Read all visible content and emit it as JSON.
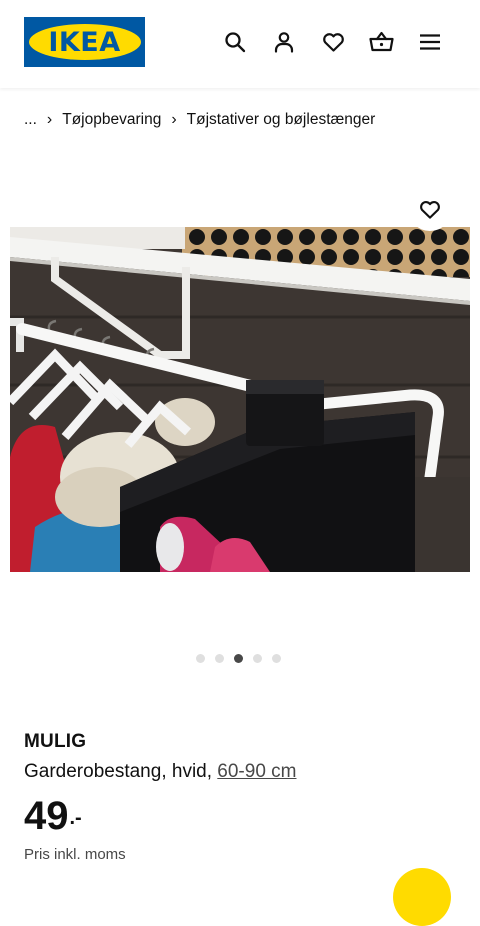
{
  "header": {
    "logo_text": "IKEA",
    "icons": [
      "search-icon",
      "user-icon",
      "heart-icon",
      "basket-icon",
      "menu-icon"
    ]
  },
  "breadcrumb": {
    "items": [
      "...",
      "Tøjopbevaring",
      "Tøjstativer og bøjlestænger"
    ]
  },
  "product": {
    "name": "MULIG",
    "description": "Garderobestang, hvid, ",
    "measurement": "60-90 cm",
    "price_integer": "49",
    "price_suffix": ".-",
    "vat_note": "Pris inkl. moms"
  },
  "gallery": {
    "image_count": 5,
    "active_index": 2
  },
  "colors": {
    "brand_blue": "#0058a3",
    "brand_yellow": "#ffdb00",
    "text": "#111111",
    "muted": "#484848",
    "dot_inactive": "#dfdfdf",
    "dot_active": "#484848"
  }
}
